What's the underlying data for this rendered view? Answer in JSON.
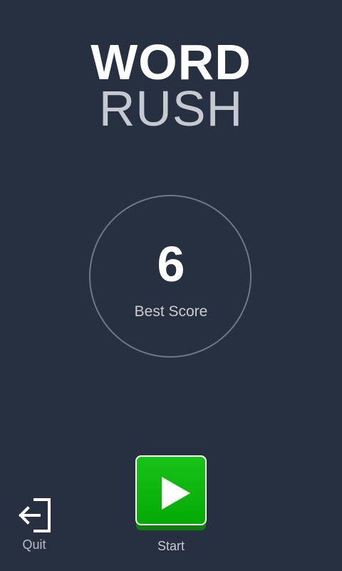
{
  "title": {
    "line1": "WORD",
    "line2": "RUSH"
  },
  "score": {
    "value": "6",
    "label": "Best Score"
  },
  "actions": {
    "quit_label": "Quit",
    "start_label": "Start",
    "quit_icon": "exit-icon",
    "start_icon": "play-icon"
  },
  "colors": {
    "background": "#273041",
    "title_primary": "#ffffff",
    "title_secondary": "#c6c9cf",
    "circle_border": "#6e7687",
    "start_green": "#18b818"
  }
}
